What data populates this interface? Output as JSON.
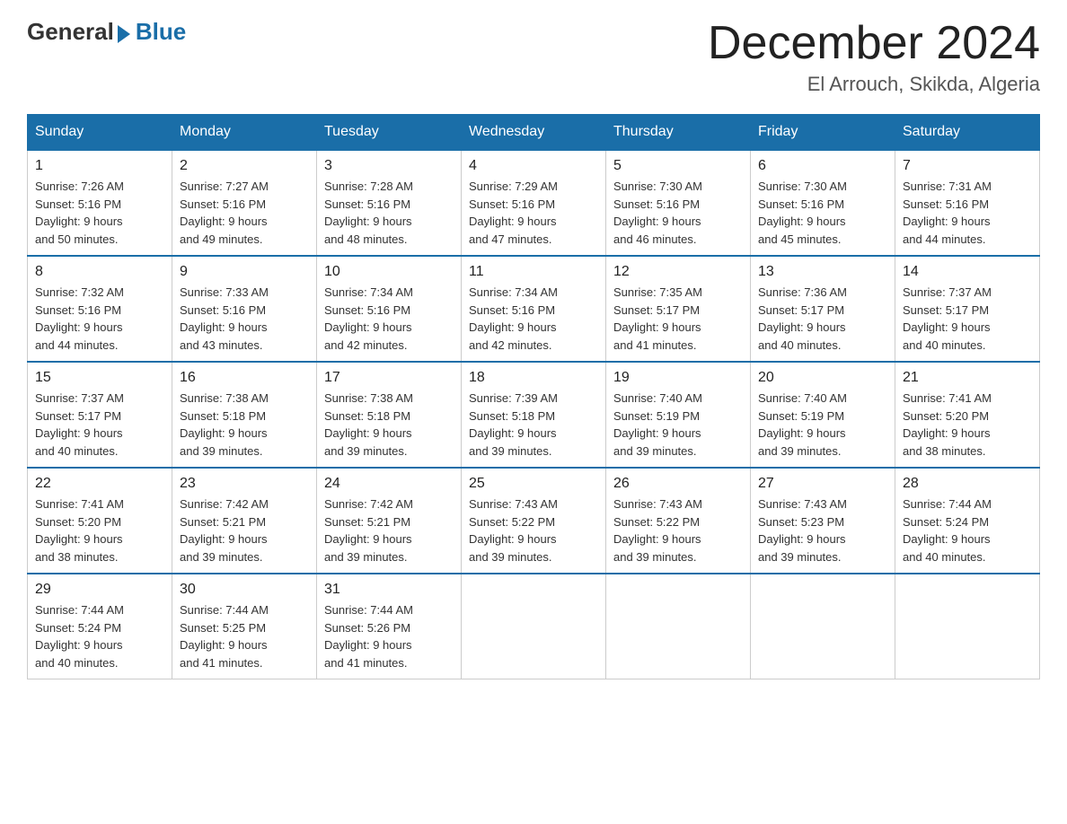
{
  "header": {
    "logo_general": "General",
    "logo_blue": "Blue",
    "month_title": "December 2024",
    "location": "El Arrouch, Skikda, Algeria"
  },
  "days_of_week": [
    "Sunday",
    "Monday",
    "Tuesday",
    "Wednesday",
    "Thursday",
    "Friday",
    "Saturday"
  ],
  "weeks": [
    [
      {
        "day": "1",
        "sunrise": "7:26 AM",
        "sunset": "5:16 PM",
        "daylight": "9 hours and 50 minutes."
      },
      {
        "day": "2",
        "sunrise": "7:27 AM",
        "sunset": "5:16 PM",
        "daylight": "9 hours and 49 minutes."
      },
      {
        "day": "3",
        "sunrise": "7:28 AM",
        "sunset": "5:16 PM",
        "daylight": "9 hours and 48 minutes."
      },
      {
        "day": "4",
        "sunrise": "7:29 AM",
        "sunset": "5:16 PM",
        "daylight": "9 hours and 47 minutes."
      },
      {
        "day": "5",
        "sunrise": "7:30 AM",
        "sunset": "5:16 PM",
        "daylight": "9 hours and 46 minutes."
      },
      {
        "day": "6",
        "sunrise": "7:30 AM",
        "sunset": "5:16 PM",
        "daylight": "9 hours and 45 minutes."
      },
      {
        "day": "7",
        "sunrise": "7:31 AM",
        "sunset": "5:16 PM",
        "daylight": "9 hours and 44 minutes."
      }
    ],
    [
      {
        "day": "8",
        "sunrise": "7:32 AM",
        "sunset": "5:16 PM",
        "daylight": "9 hours and 44 minutes."
      },
      {
        "day": "9",
        "sunrise": "7:33 AM",
        "sunset": "5:16 PM",
        "daylight": "9 hours and 43 minutes."
      },
      {
        "day": "10",
        "sunrise": "7:34 AM",
        "sunset": "5:16 PM",
        "daylight": "9 hours and 42 minutes."
      },
      {
        "day": "11",
        "sunrise": "7:34 AM",
        "sunset": "5:16 PM",
        "daylight": "9 hours and 42 minutes."
      },
      {
        "day": "12",
        "sunrise": "7:35 AM",
        "sunset": "5:17 PM",
        "daylight": "9 hours and 41 minutes."
      },
      {
        "day": "13",
        "sunrise": "7:36 AM",
        "sunset": "5:17 PM",
        "daylight": "9 hours and 40 minutes."
      },
      {
        "day": "14",
        "sunrise": "7:37 AM",
        "sunset": "5:17 PM",
        "daylight": "9 hours and 40 minutes."
      }
    ],
    [
      {
        "day": "15",
        "sunrise": "7:37 AM",
        "sunset": "5:17 PM",
        "daylight": "9 hours and 40 minutes."
      },
      {
        "day": "16",
        "sunrise": "7:38 AM",
        "sunset": "5:18 PM",
        "daylight": "9 hours and 39 minutes."
      },
      {
        "day": "17",
        "sunrise": "7:38 AM",
        "sunset": "5:18 PM",
        "daylight": "9 hours and 39 minutes."
      },
      {
        "day": "18",
        "sunrise": "7:39 AM",
        "sunset": "5:18 PM",
        "daylight": "9 hours and 39 minutes."
      },
      {
        "day": "19",
        "sunrise": "7:40 AM",
        "sunset": "5:19 PM",
        "daylight": "9 hours and 39 minutes."
      },
      {
        "day": "20",
        "sunrise": "7:40 AM",
        "sunset": "5:19 PM",
        "daylight": "9 hours and 39 minutes."
      },
      {
        "day": "21",
        "sunrise": "7:41 AM",
        "sunset": "5:20 PM",
        "daylight": "9 hours and 38 minutes."
      }
    ],
    [
      {
        "day": "22",
        "sunrise": "7:41 AM",
        "sunset": "5:20 PM",
        "daylight": "9 hours and 38 minutes."
      },
      {
        "day": "23",
        "sunrise": "7:42 AM",
        "sunset": "5:21 PM",
        "daylight": "9 hours and 39 minutes."
      },
      {
        "day": "24",
        "sunrise": "7:42 AM",
        "sunset": "5:21 PM",
        "daylight": "9 hours and 39 minutes."
      },
      {
        "day": "25",
        "sunrise": "7:43 AM",
        "sunset": "5:22 PM",
        "daylight": "9 hours and 39 minutes."
      },
      {
        "day": "26",
        "sunrise": "7:43 AM",
        "sunset": "5:22 PM",
        "daylight": "9 hours and 39 minutes."
      },
      {
        "day": "27",
        "sunrise": "7:43 AM",
        "sunset": "5:23 PM",
        "daylight": "9 hours and 39 minutes."
      },
      {
        "day": "28",
        "sunrise": "7:44 AM",
        "sunset": "5:24 PM",
        "daylight": "9 hours and 40 minutes."
      }
    ],
    [
      {
        "day": "29",
        "sunrise": "7:44 AM",
        "sunset": "5:24 PM",
        "daylight": "9 hours and 40 minutes."
      },
      {
        "day": "30",
        "sunrise": "7:44 AM",
        "sunset": "5:25 PM",
        "daylight": "9 hours and 41 minutes."
      },
      {
        "day": "31",
        "sunrise": "7:44 AM",
        "sunset": "5:26 PM",
        "daylight": "9 hours and 41 minutes."
      },
      null,
      null,
      null,
      null
    ]
  ]
}
